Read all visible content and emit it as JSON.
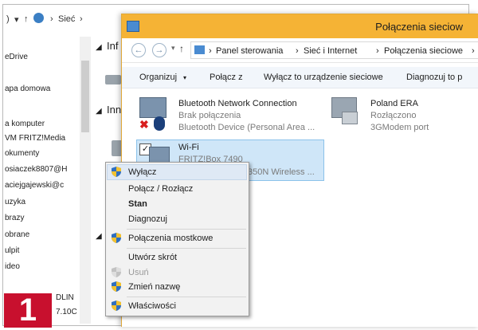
{
  "background_window": {
    "address": {
      "left_crumb": ")",
      "arrow": "▾",
      "up": "↑",
      "crumb": "Sieć",
      "sep": "›"
    },
    "nav_items": [
      "eDrive",
      "apa domowa",
      "a komputer",
      "VM FRITZ!Media",
      "okumenty",
      "osiaczek8807@H",
      "aciejgajewski@c",
      "uzyka",
      "brazy",
      "obrane",
      "ulpit",
      "ideo",
      "DLIN",
      "7.10C"
    ],
    "groups": [
      "Inf",
      "Inn"
    ],
    "expand_glyph": "◢"
  },
  "window": {
    "title": "Połączenia sieciow",
    "address": {
      "back": "←",
      "forward": "→",
      "up": "↑",
      "crumbs": [
        "Panel sterowania",
        "Sieć i Internet",
        "Połączenia sieciowe"
      ],
      "sep": "›"
    },
    "toolbar": {
      "organize": "Organizuj",
      "organize_arrow": "▾",
      "connect": "Połącz z",
      "disable": "Wyłącz to urządzenie sieciowe",
      "diagnose": "Diagnozuj to p"
    },
    "connections": [
      {
        "name": "Bluetooth Network Connection",
        "status": "Brak połączenia",
        "device": "Bluetooth Device (Personal Area ..."
      },
      {
        "name": "Poland ERA",
        "status": "Rozłączono",
        "device": "3GModem port"
      },
      {
        "name": "Wi-Fi",
        "status": "FRITZ!Box 7490",
        "device": "350N Wireless ..."
      }
    ]
  },
  "context_menu": {
    "items": [
      {
        "label": "Wyłącz",
        "shield": true
      },
      {
        "label": "Połącz / Rozłącz"
      },
      {
        "label": "Stan",
        "bold": true
      },
      {
        "label": "Diagnozuj"
      },
      {
        "label": "Połączenia mostkowe",
        "shield": true
      },
      {
        "label": "Utwórz skrót"
      },
      {
        "label": "Usuń",
        "shield": true,
        "disabled": true
      },
      {
        "label": "Zmień nazwę",
        "shield": true
      },
      {
        "label": "Właściwości",
        "shield": true
      }
    ]
  },
  "step_badge": "1",
  "colors": {
    "titlebar": "#f5b335",
    "selection": "#cfe6f8",
    "badge": "#c8102e",
    "shield_blue": "#2f6fc0",
    "shield_yellow": "#f3c230"
  }
}
